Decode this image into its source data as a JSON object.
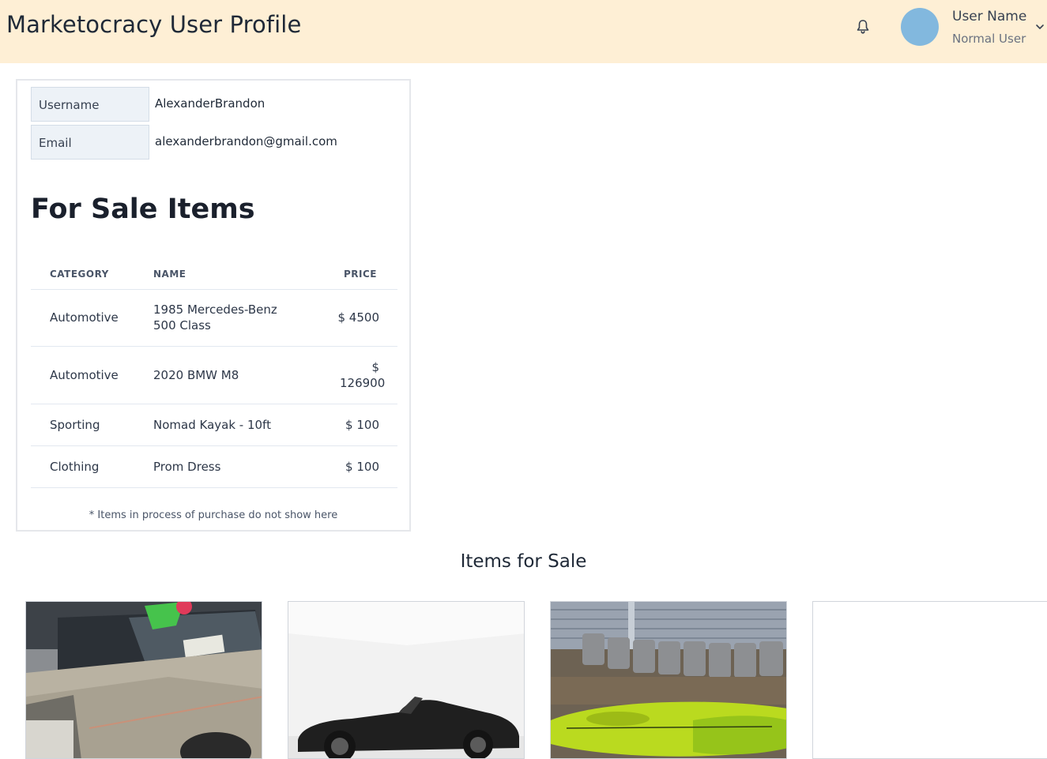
{
  "header": {
    "title": "Marketocracy User Profile",
    "bell_icon": "bell-icon",
    "user": {
      "name": "User Name",
      "role": "Normal User"
    },
    "chevron_icon": "chevron-down-icon",
    "background_color": "#feefd5",
    "avatar_color": "#82b8de"
  },
  "profile": {
    "username_label": "Username",
    "username_value": "AlexanderBrandon",
    "email_label": "Email",
    "email_value": "alexanderbrandon@gmail.com"
  },
  "for_sale": {
    "title": "For Sale Items",
    "columns": [
      "CATEGORY",
      "NAME",
      "PRICE"
    ],
    "rows": [
      {
        "category": "Automotive",
        "name": "1985 Mercedes-Benz 500 Class",
        "price": "$ 4500"
      },
      {
        "category": "Automotive",
        "name": "2020 BMW M8",
        "price": "$ 126900"
      },
      {
        "category": "Sporting",
        "name": "Nomad Kayak - 10ft",
        "price": "$ 100"
      },
      {
        "category": "Clothing",
        "name": "Prom Dress",
        "price": "$ 100"
      }
    ],
    "note": "* Items in process of purchase do not show here"
  },
  "gallery": {
    "title": "Items for Sale",
    "items": [
      {
        "image": "mercedes-photo"
      },
      {
        "image": "bmw-photo"
      },
      {
        "image": "kayak-photo"
      },
      {
        "image": "blank-photo"
      }
    ]
  }
}
